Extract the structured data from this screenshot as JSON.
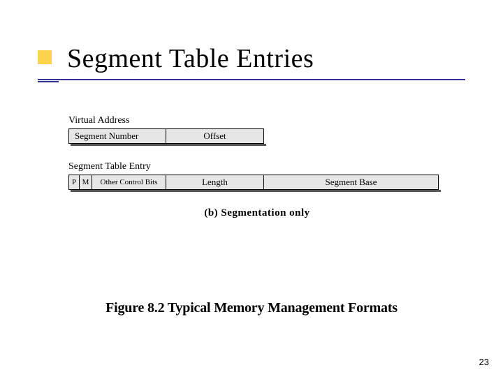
{
  "header": {
    "title": "Segment Table Entries"
  },
  "figure": {
    "virtual_address_label": "Virtual Address",
    "va_cells": {
      "segnum": "Segment Number",
      "offset": "Offset"
    },
    "ste_label": "Segment Table Entry",
    "ste_cells": {
      "p": "P",
      "m": "M",
      "ocb": "Other Control Bits",
      "len": "Length",
      "base": "Segment Base"
    },
    "sub_caption": "(b) Segmentation only",
    "main_caption": "Figure 8.2  Typical Memory Management Formats"
  },
  "page_number": "23"
}
